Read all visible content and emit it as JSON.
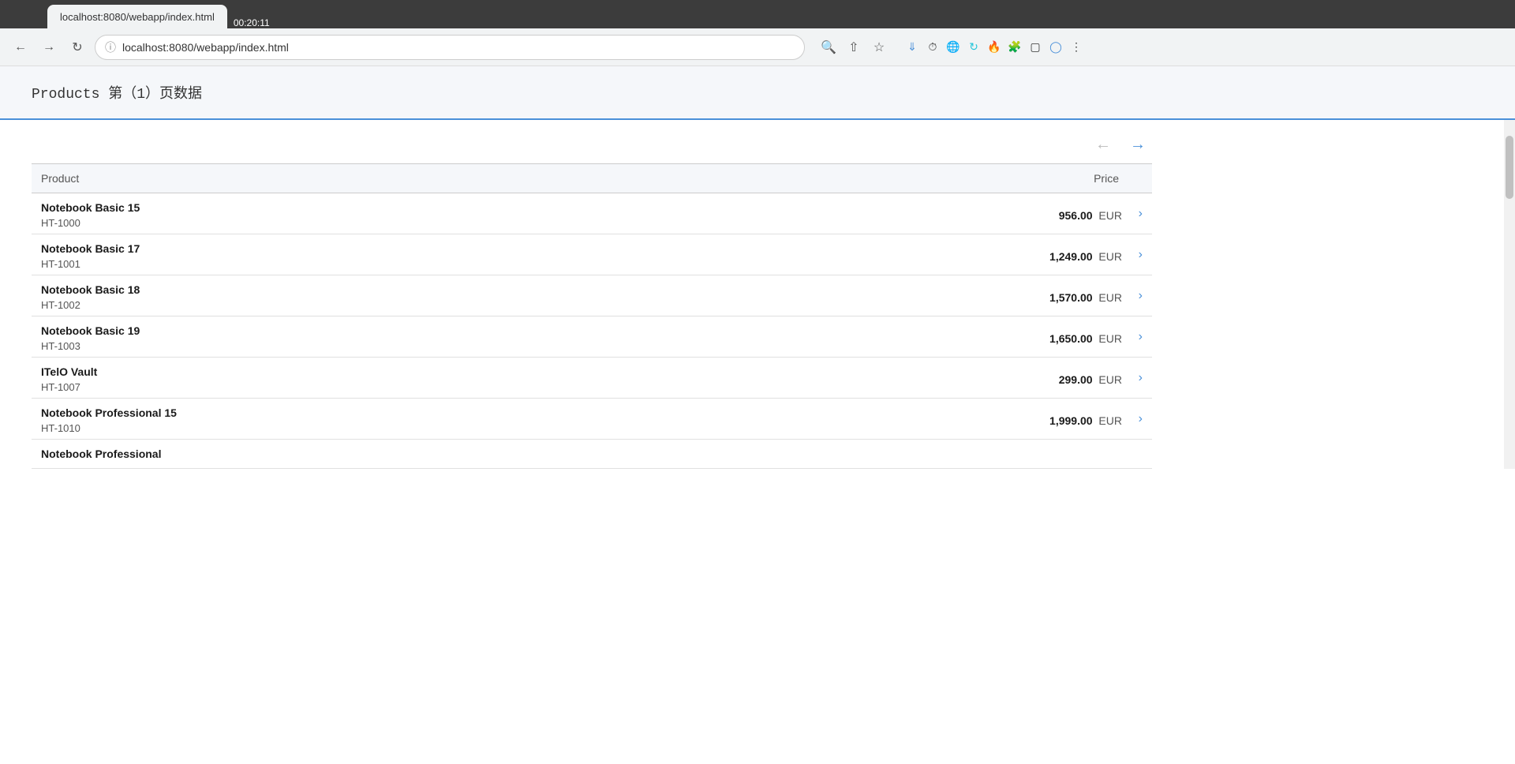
{
  "browser": {
    "tab_title": "localhost:8080/webapp/index.html",
    "address": "localhost:8080/webapp/index.html",
    "time": "00:20:11",
    "back_disabled": false,
    "forward_disabled": false
  },
  "page": {
    "title": "Products 第（1）页数据",
    "pagination": {
      "prev_label": "←",
      "next_label": "→"
    },
    "table": {
      "col_product": "Product",
      "col_price": "Price",
      "rows": [
        {
          "name": "Notebook Basic 15",
          "id": "HT-1000",
          "price": "956.00",
          "currency": "EUR"
        },
        {
          "name": "Notebook Basic 17",
          "id": "HT-1001",
          "price": "1,249.00",
          "currency": "EUR"
        },
        {
          "name": "Notebook Basic 18",
          "id": "HT-1002",
          "price": "1,570.00",
          "currency": "EUR"
        },
        {
          "name": "Notebook Basic 19",
          "id": "HT-1003",
          "price": "1,650.00",
          "currency": "EUR"
        },
        {
          "name": "ITelO Vault",
          "id": "HT-1007",
          "price": "299.00",
          "currency": "EUR"
        },
        {
          "name": "Notebook Professional 15",
          "id": "HT-1010",
          "price": "1,999.00",
          "currency": "EUR"
        },
        {
          "name": "Notebook Professional",
          "id": "",
          "price": "",
          "currency": ""
        }
      ]
    }
  }
}
